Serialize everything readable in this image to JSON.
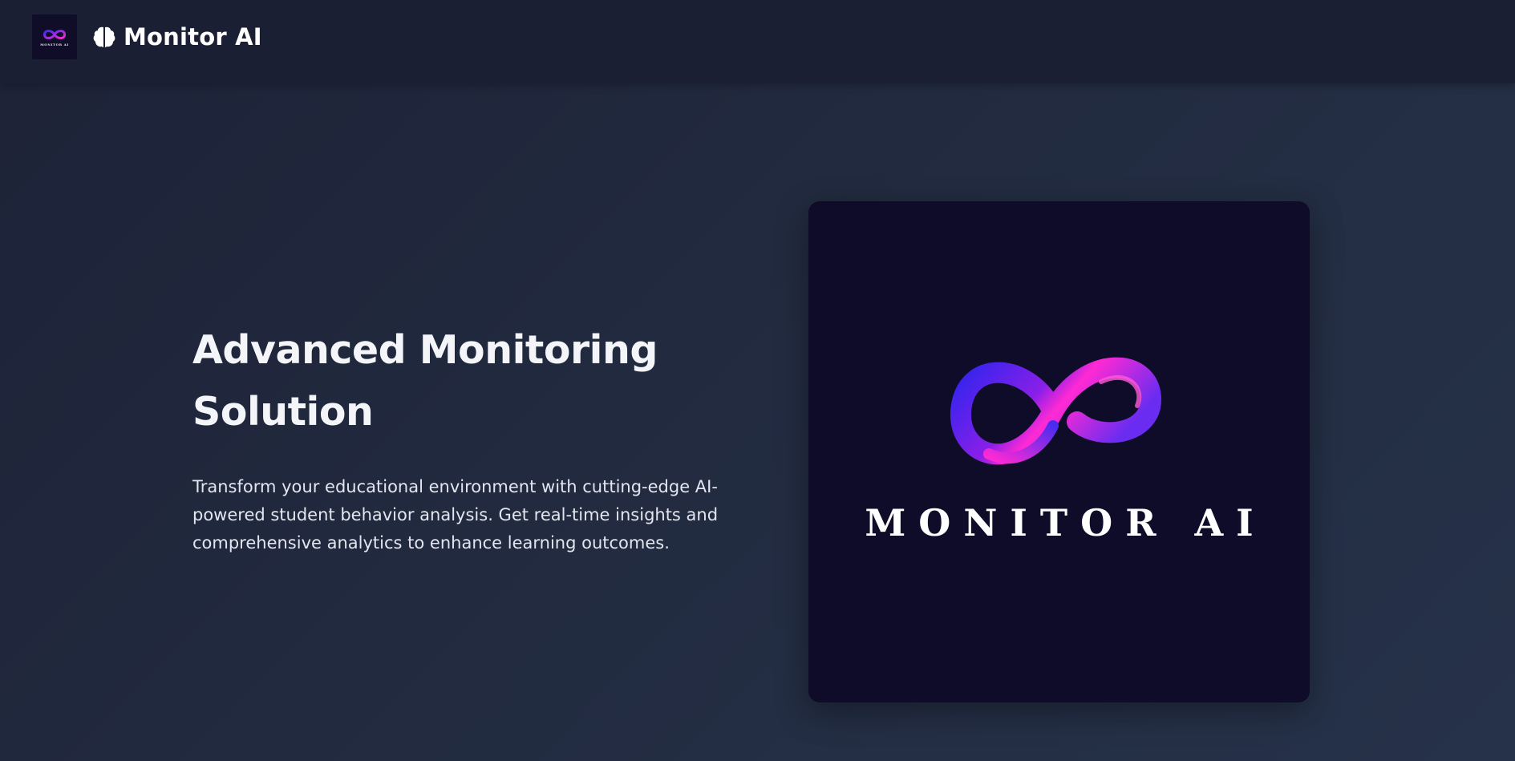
{
  "header": {
    "thumb_logo_text": "MONITOR AI",
    "brand_icon": "brain-icon",
    "brand_name": "Monitor AI"
  },
  "hero": {
    "title": "Advanced Monitoring Solution",
    "description": "Transform your educational environment with cutting-edge AI-powered student behavior analysis. Get real-time insights and comprehensive analytics to enhance learning outcomes."
  },
  "showcase": {
    "icon": "infinity-icon",
    "logo_text": "MONITOR AI"
  },
  "colors": {
    "header_bg": "#1b1f33",
    "page_bg": "#222b40",
    "card_bg": "#0f0c2a",
    "accent_blue": "#3b2cf0",
    "accent_pink": "#ff2ad4"
  }
}
